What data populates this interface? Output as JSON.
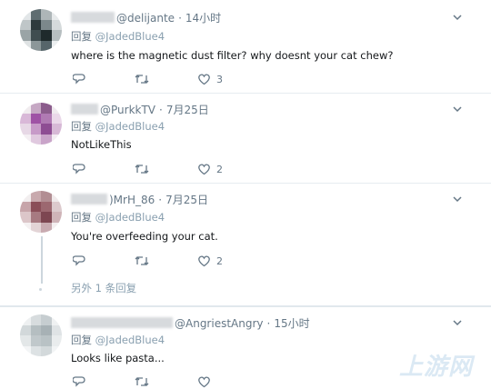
{
  "replies": [
    {
      "username": "@delijante",
      "time": "14小时",
      "reply_prefix": "回复",
      "reply_handle": "@JadedBlue4",
      "text": "where is the magnetic dust filter? why doesnt your cat chew?",
      "like_count": "3"
    },
    {
      "username": "PurkkTV",
      "time": "7月25日",
      "reply_prefix": "回复",
      "reply_handle": "@JadedBlue4",
      "text": "NotLikeThis",
      "like_count": "2"
    },
    {
      "username": ")MrH_86",
      "time": "7月25日",
      "reply_prefix": "回复",
      "reply_handle": "@JadedBlue4",
      "text": "You're overfeeding your cat.",
      "like_count": "2",
      "more_replies": "另外 1 条回复"
    },
    {
      "username": "@AngriestAngry",
      "time": "15小时",
      "reply_prefix": "回复",
      "reply_handle": "@JadedBlue4",
      "text": "Looks like pasta...",
      "like_count": ""
    }
  ],
  "icons": {
    "reply": "reply-icon",
    "retweet": "retweet-icon",
    "like": "heart-icon",
    "more": "chevron-down-icon"
  },
  "colors": {
    "secondary_text": "#657786",
    "icon": "#657786",
    "divider": "#e6ecf0",
    "thread_line": "#ccd6dd"
  }
}
